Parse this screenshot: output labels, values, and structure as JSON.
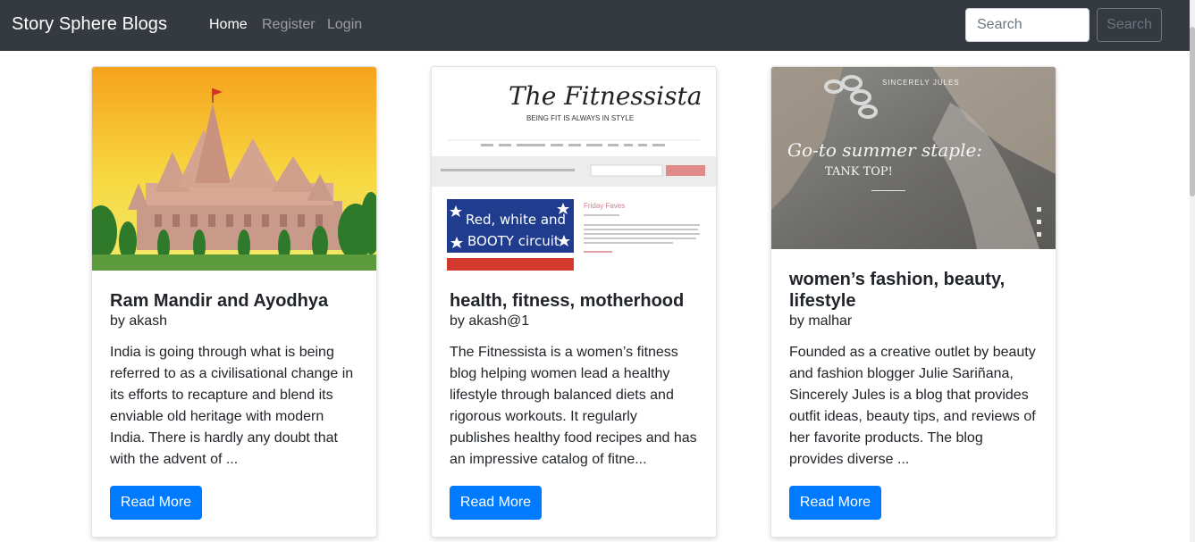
{
  "navbar": {
    "brand": "Story Sphere Blogs",
    "links": [
      {
        "label": "Home",
        "active": true
      },
      {
        "label": "Register",
        "active": false
      },
      {
        "label": "Login",
        "active": false
      }
    ],
    "search_placeholder": "Search",
    "search_button": "Search"
  },
  "cards": [
    {
      "image_subject": "temple-photo",
      "title": "Ram Mandir and Ayodhya",
      "author": "by akash",
      "excerpt": "India is going through what is being referred to as a civilisational change in its efforts to recapture and blend its enviable old heritage with modern India. There is hardly any doubt that with the advent of ...",
      "button": "Read More"
    },
    {
      "image_subject": "blog-screenshot",
      "image_text": {
        "logo": "The Fitnessista",
        "tagline": "BEING FIT IS ALWAYS IN STYLE",
        "banner_line1": "Red, white and",
        "banner_line2": "BOOTY circuit",
        "post_title": "Friday Faves"
      },
      "title": "health, fitness, motherhood",
      "author": "by akash@1",
      "excerpt": "The Fitnessista is a women’s fitness blog helping women lead a healthy lifestyle through balanced diets and rigorous workouts. It regularly publishes healthy food recipes and has an impressive catalog of fitne...",
      "button": "Read More"
    },
    {
      "image_subject": "fashion-photo",
      "image_text": {
        "header": "SINCERELY JULES",
        "script": "Go-to summer staple:",
        "caption": "TANK TOP!"
      },
      "title": "women’s fashion, beauty, lifestyle",
      "author": "by malhar",
      "excerpt": "Founded as a creative outlet by beauty and fashion blogger Julie Sariñana, Sincerely Jules is a blog that provides outfit ideas, beauty tips, and reviews of her favorite products. The blog provides diverse ...",
      "button": "Read More"
    }
  ],
  "colors": {
    "navbar_bg": "#343a40",
    "primary": "#007bff",
    "text": "#212529"
  }
}
